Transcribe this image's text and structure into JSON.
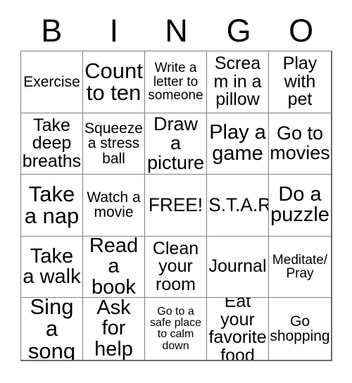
{
  "card": {
    "title": "BINGO",
    "header_letters": [
      "B",
      "I",
      "N",
      "G",
      "O"
    ],
    "columns": 5,
    "rows": 5,
    "free_space_label": "FREE!",
    "free_space_position": "center",
    "colors": {
      "background": "#ffffff",
      "text": "#000000",
      "grid_line": "#808080",
      "outer_border": "#6b6b6b"
    },
    "squares": [
      {
        "text": "Exercise",
        "size": "sm"
      },
      {
        "text": "Count to ten",
        "size": "xxl"
      },
      {
        "text": "Write a letter to someone",
        "size": "xs"
      },
      {
        "text": "Scream in a pillow",
        "size": "md"
      },
      {
        "text": "Play with pet",
        "size": "md"
      },
      {
        "text": "Take deep breaths",
        "size": "md"
      },
      {
        "text": "Squeeze a stress ball",
        "size": "sm"
      },
      {
        "text": "Draw a picture",
        "size": "lg"
      },
      {
        "text": "Play a game",
        "size": "xl"
      },
      {
        "text": "Go to movies",
        "size": "lg"
      },
      {
        "text": "Take a nap",
        "size": "xxl"
      },
      {
        "text": "Watch a movie",
        "size": "sm"
      },
      {
        "text": "FREE!",
        "size": "fit"
      },
      {
        "text": "S.T.A.R",
        "size": "fit"
      },
      {
        "text": "Do a puzzle",
        "size": "xl"
      },
      {
        "text": "Take a walk",
        "size": "xl"
      },
      {
        "text": "Read a book",
        "size": "xl"
      },
      {
        "text": "Clean your room",
        "size": "md"
      },
      {
        "text": "Journal",
        "size": "md"
      },
      {
        "text": "Meditate/ Pray",
        "size": "xs"
      },
      {
        "text": "Sing a song",
        "size": "xxl"
      },
      {
        "text": "Ask for help",
        "size": "xl"
      },
      {
        "text": "Go to a safe place to calm down",
        "size": "xxs"
      },
      {
        "text": "Eat your favorite food",
        "size": "md"
      },
      {
        "text": "Go shopping",
        "size": "sm"
      }
    ]
  }
}
